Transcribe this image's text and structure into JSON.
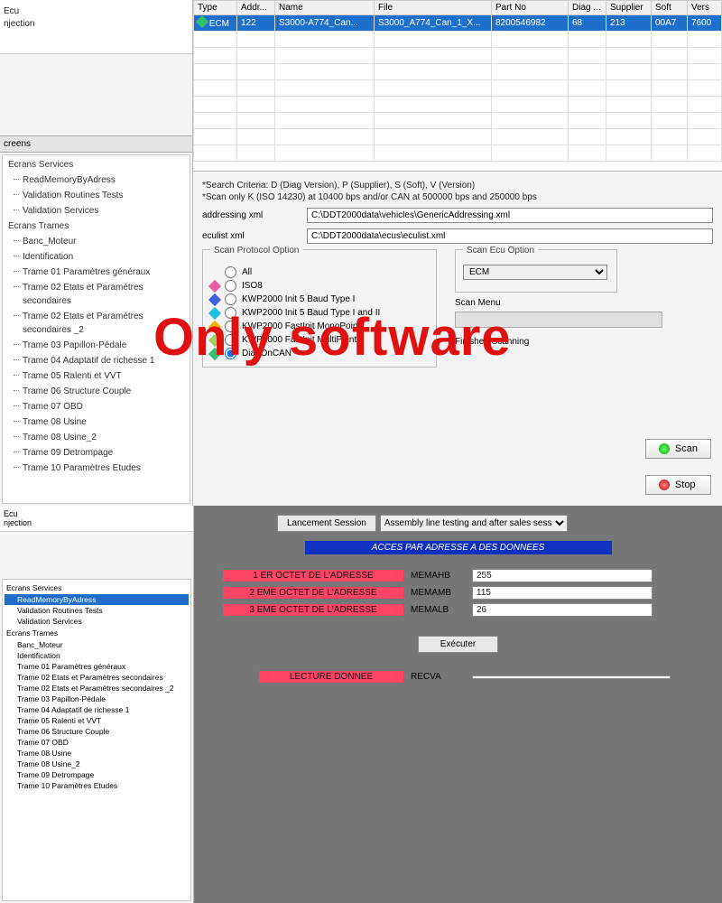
{
  "leftHeader": {
    "l1": "Ecu",
    "l2": "njection"
  },
  "treeTitle": "creens",
  "tree": {
    "g1": "Ecrans Services",
    "i1": "ReadMemoryByAdress",
    "i2": "Validation Routines Tests",
    "i3": "Validation Services",
    "g2": "Ecrans Trames",
    "i4": "Banc_Moteur",
    "i5": "Identification",
    "i6": "Trame 01 Paramètres généraux",
    "i7": "Trame 02 Etats et Paramètres secondaires",
    "i8": "Trame 02 Etats et Paramètres secondaires _2",
    "i9": "Trame 03 Papillon-Pédale",
    "i10": "Trame 04 Adaptatif de richesse 1",
    "i11": "Trame 05 Ralenti et VVT",
    "i12": "Trame 06 Structure Couple",
    "i13": "Trame 07 OBD",
    "i14": "Trame 08 Usine",
    "i15": "Trame 08 Usine_2",
    "i16": "Trame 09 Detrompage",
    "i17": "Trame 10 Paramètres Etudes"
  },
  "grid": {
    "headers": {
      "c1": "Type",
      "c2": "Addr...",
      "c3": "Name",
      "c4": "File",
      "c5": "Part No",
      "c6": "Diag ...",
      "c7": "Supplier",
      "c8": "Soft",
      "c9": "Vers"
    },
    "row": {
      "c1": "ECM",
      "c2": "122",
      "c3": "S3000-A774_Can...",
      "c4": "S3000_A774_Can_1_X...",
      "c5": "8200546982",
      "c6": "68",
      "c7": "213",
      "c8": "00A7",
      "c9": "7600"
    }
  },
  "info": {
    "note1": "*Search Criteria: D (Diag Version), P (Supplier), S (Soft), V (Version)",
    "note2": "*Scan only K (ISO 14230) at 10400 bps and/or CAN at 500000 bps and 250000 bps",
    "addrLabel": "addressing xml",
    "addrVal": "C:\\DDT2000data\\vehicles\\GenericAddressing.xml",
    "eculistLabel": "eculist xml",
    "eculistVal": "C:\\DDT2000data\\ecus\\eculist.xml",
    "scanProto": "Scan Protocol Option",
    "scanEcu": "Scan Ecu Option",
    "ecuSelected": "ECM",
    "r1": "All",
    "r2": "ISO8",
    "r3": "KWP2000 Init 5 Baud Type I",
    "r4": "KWP2000 Init 5 Baud Type I and II",
    "r5": "KWP2000 FastInit MonoPoint",
    "r6": "KWP2000 FastInit MultiPoint",
    "r7": "DiagOnCAN",
    "scanMenu": "Scan Menu",
    "finished": "Finished Scanning",
    "scanBtn": "Scan",
    "stopBtn": "Stop"
  },
  "bottom": {
    "hdr1": "Ecu",
    "hdr2": "njection",
    "sessBtn": "Lancement Session",
    "sessSel": "Assembly line testing and after sales sess",
    "title": "ACCES PAR ADRESSE A DES DONNEES",
    "a1": "1 ER OCTET DE L'ADRESSE",
    "m1": "MEMAHB",
    "v1": "255",
    "a2": "2 EME OCTET DE L'ADRESSE",
    "m2": "MEMAMB",
    "v2": "115",
    "a3": "3 EME OCTET DE L'ADRESSE",
    "m3": "MEMALB",
    "v3": "26",
    "exec": "Exécuter",
    "read": "LECTURE DONNEE",
    "readKey": "RECVA"
  },
  "overlay": "Only software",
  "colors": {
    "magenta": "#e660a8",
    "cyan": "#20c0e0",
    "yellow": "#f0b000",
    "green": "#30c030",
    "blue": "#4060e0"
  }
}
